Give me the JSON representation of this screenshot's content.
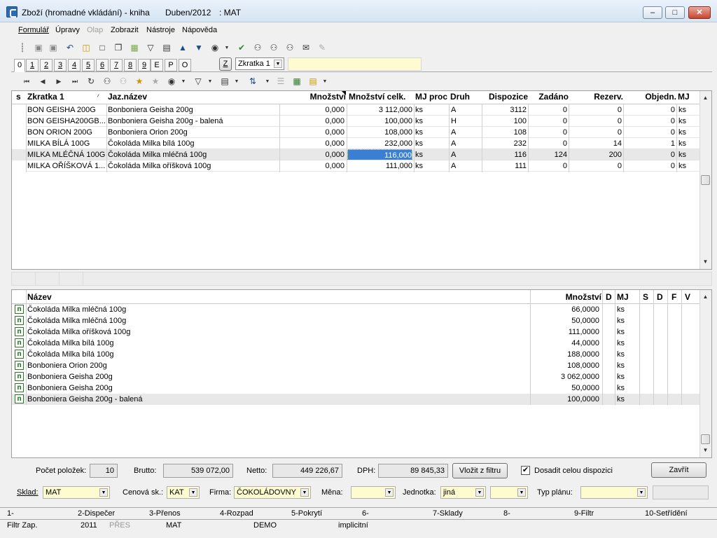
{
  "window": {
    "title": "Zboží (hromadné vkládání) - kniha",
    "period": "Duben/2012",
    "user": ": MAT"
  },
  "menu": [
    "Formulář",
    "Úpravy",
    "Olap",
    "Zobrazit",
    "Nástroje",
    "Nápověda"
  ],
  "tabs": [
    "0",
    "1",
    "2",
    "3",
    "4",
    "5",
    "6",
    "7",
    "8",
    "9",
    "E",
    "P",
    "O"
  ],
  "z_button": "Z",
  "sort_select": "Zkratka 1",
  "top_grid": {
    "headers": {
      "s": "s",
      "zkratka": "Zkratka 1",
      "sort": "⁄",
      "name": "Jaz.název",
      "mnozstvi": "Množství",
      "celk": "Množství celk.",
      "mj_proc": "MJ proc",
      "druh": "Druh",
      "dispozice": "Dispozice",
      "zadano": "Zadáno",
      "rezerv": "Rezerv.",
      "objedn": "Objedn.",
      "mj": "MJ"
    },
    "rows": [
      {
        "zkratka": "BON GEISHA 200G",
        "name": "Bonboniera Geisha 200g",
        "mnozstvi": "0,000",
        "celk": "3 112,000",
        "mj_proc": "ks",
        "druh": "A",
        "dispozice": "3112",
        "zadano": "0",
        "rezerv": "0",
        "objedn": "0",
        "mj": "ks"
      },
      {
        "zkratka": "BON GEISHA200GB...",
        "name": "Bonboniera Geisha 200g - balená",
        "mnozstvi": "0,000",
        "celk": "100,000",
        "mj_proc": "ks",
        "druh": "H",
        "dispozice": "100",
        "zadano": "0",
        "rezerv": "0",
        "objedn": "0",
        "mj": "ks"
      },
      {
        "zkratka": "BON ORION 200G",
        "name": "Bonboniera Orion 200g",
        "mnozstvi": "0,000",
        "celk": "108,000",
        "mj_proc": "ks",
        "druh": "A",
        "dispozice": "108",
        "zadano": "0",
        "rezerv": "0",
        "objedn": "0",
        "mj": "ks"
      },
      {
        "zkratka": "MILKA BÍLÁ 100G",
        "name": "Čokoláda Milka bílá 100g",
        "mnozstvi": "0,000",
        "celk": "232,000",
        "mj_proc": "ks",
        "druh": "A",
        "dispozice": "232",
        "zadano": "0",
        "rezerv": "14",
        "objedn": "1",
        "mj": "ks"
      },
      {
        "zkratka": "MILKA MLÉČNÁ 100G",
        "name": "Čokoláda Milka mléčná 100g",
        "mnozstvi": "0,000",
        "celk": "116,000",
        "mj_proc": "ks",
        "druh": "A",
        "dispozice": "116",
        "zadano": "124",
        "rezerv": "200",
        "objedn": "0",
        "mj": "ks"
      },
      {
        "zkratka": "MILKA OŘÍŠKOVÁ 1...",
        "name": "Čokoláda Milka oříšková 100g",
        "mnozstvi": "0,000",
        "celk": "111,000",
        "mj_proc": "ks",
        "druh": "A",
        "dispozice": "111",
        "zadano": "0",
        "rezerv": "0",
        "objedn": "0",
        "mj": "ks"
      }
    ]
  },
  "bottom_grid": {
    "headers": {
      "nazev": "Název",
      "mnozstvi": "Množství",
      "d": "D",
      "mj": "MJ",
      "s": "S",
      "dd": "D",
      "f": "F",
      "v": "V"
    },
    "rows": [
      {
        "nazev": "Čokoláda Milka mléčná 100g",
        "mnozstvi": "66,0000",
        "mj": "ks"
      },
      {
        "nazev": "Čokoláda Milka mléčná 100g",
        "mnozstvi": "50,0000",
        "mj": "ks"
      },
      {
        "nazev": "Čokoláda Milka oříšková 100g",
        "mnozstvi": "111,0000",
        "mj": "ks"
      },
      {
        "nazev": "Čokoláda Milka bílá 100g",
        "mnozstvi": "44,0000",
        "mj": "ks"
      },
      {
        "nazev": "Čokoláda Milka bílá 100g",
        "mnozstvi": "188,0000",
        "mj": "ks"
      },
      {
        "nazev": "Bonboniera Orion 200g",
        "mnozstvi": "108,0000",
        "mj": "ks"
      },
      {
        "nazev": "Bonboniera Geisha 200g",
        "mnozstvi": "3 062,0000",
        "mj": "ks"
      },
      {
        "nazev": "Bonboniera Geisha 200g",
        "mnozstvi": "50,0000",
        "mj": "ks"
      },
      {
        "nazev": "Bonboniera Geisha 200g - balená",
        "mnozstvi": "100,0000",
        "mj": "ks"
      }
    ]
  },
  "summary": {
    "count_label": "Počet položek:",
    "count": "10",
    "brutto_label": "Brutto:",
    "brutto": "539 072,00",
    "netto_label": "Netto:",
    "netto": "449 226,67",
    "dph_label": "DPH:",
    "dph": "89 845,33",
    "insert_button": "Vložit z filtru",
    "checkbox_label": "Dosadit celou dispozici",
    "close_button": "Zavřít"
  },
  "filters": {
    "sklad_label": "Sklad:",
    "sklad": "MAT",
    "cenova_label": "Cenová sk.:",
    "cenova": "KAT",
    "firma_label": "Firma:",
    "firma": "ČOKOLÁDOVNY",
    "mena_label": "Měna:",
    "mena": "",
    "jednotka_label": "Jednotka:",
    "jednotka": "jiná",
    "typ_label": "Typ plánu:",
    "typ": ""
  },
  "fkeys": [
    "1-",
    "2-Dispečer",
    "3-Přenos",
    "4-Rozpad",
    "5-Pokrytí",
    "6-",
    "7-Sklady",
    "8-",
    "9-Filtr",
    "10-Setřídění"
  ],
  "statusbar": [
    "Filtr Zap.",
    "2011",
    "PŘES",
    "MAT",
    "DEMO",
    "implicitní"
  ]
}
